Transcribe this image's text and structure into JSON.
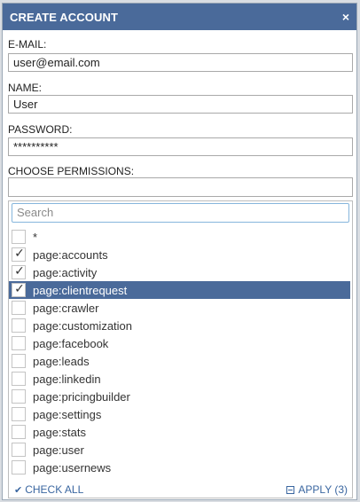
{
  "dialog": {
    "title": "CREATE ACCOUNT",
    "close_icon": "×"
  },
  "form": {
    "email_label": "E-MAIL:",
    "email_value": "user@email.com",
    "name_label": "NAME:",
    "name_value": "User",
    "password_label": "PASSWORD:",
    "password_value": "**********",
    "permissions_label": "CHOOSE PERMISSIONS:"
  },
  "dropdown": {
    "search_placeholder": "Search",
    "options": [
      {
        "label": "*",
        "checked": false
      },
      {
        "label": "page:accounts",
        "checked": true
      },
      {
        "label": "page:activity",
        "checked": true
      },
      {
        "label": "page:clientrequest",
        "checked": true,
        "highlighted": true
      },
      {
        "label": "page:crawler",
        "checked": false
      },
      {
        "label": "page:customization",
        "checked": false
      },
      {
        "label": "page:facebook",
        "checked": false
      },
      {
        "label": "page:leads",
        "checked": false
      },
      {
        "label": "page:linkedin",
        "checked": false
      },
      {
        "label": "page:pricingbuilder",
        "checked": false
      },
      {
        "label": "page:settings",
        "checked": false
      },
      {
        "label": "page:stats",
        "checked": false
      },
      {
        "label": "page:user",
        "checked": false
      },
      {
        "label": "page:usernews",
        "checked": false
      }
    ],
    "check_all_label": "CHECK ALL",
    "apply_label": "APPLY (3)"
  },
  "colors": {
    "titlebar": "#4a6a9a",
    "highlight": "#4a6a9a",
    "link": "#3a66a0"
  }
}
